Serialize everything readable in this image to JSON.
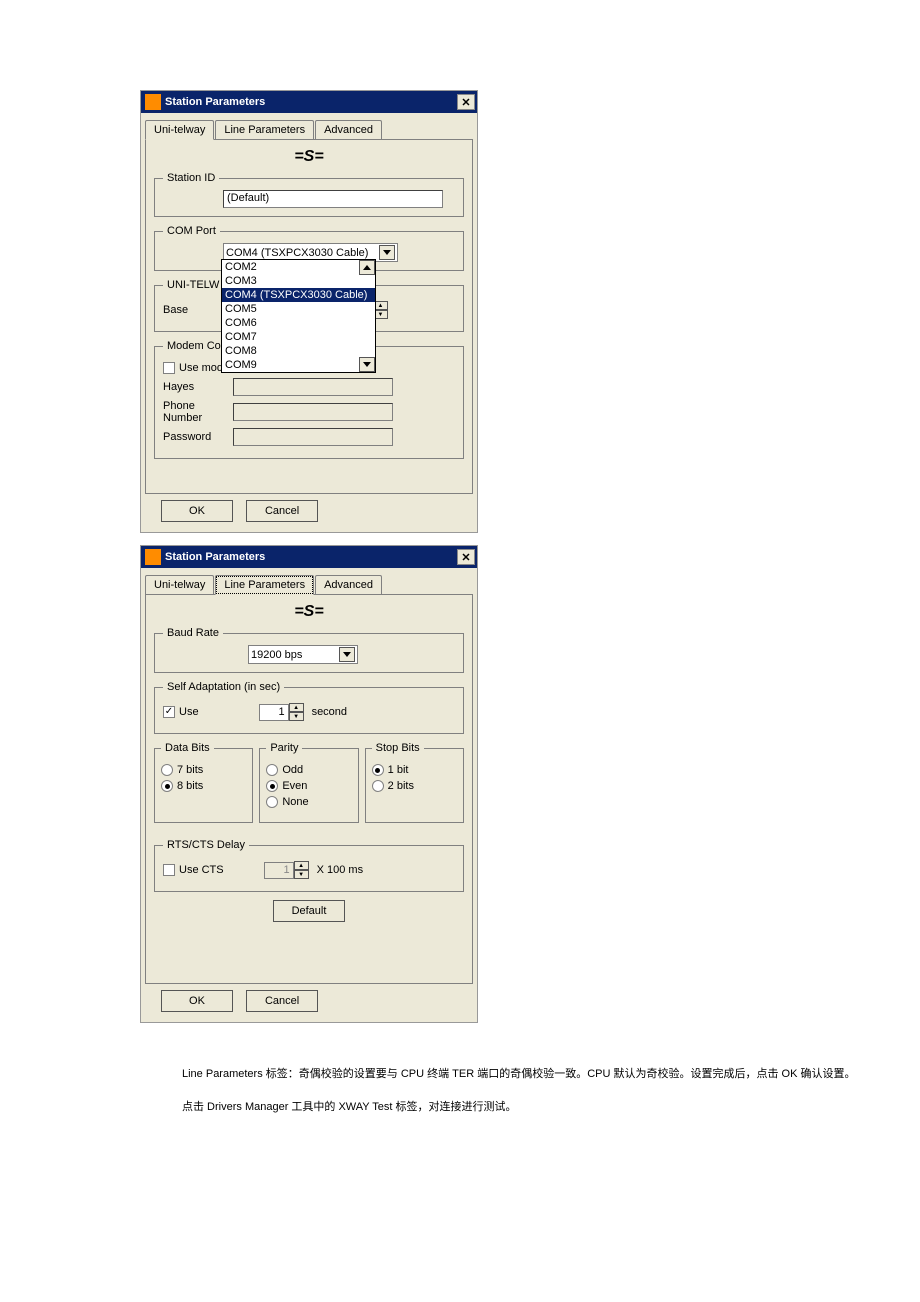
{
  "dialog1": {
    "title": "Station Parameters",
    "tabs": {
      "t1": "Uni-telway",
      "t2": "Line Parameters",
      "t3": "Advanced"
    },
    "station_id": {
      "legend": "Station ID",
      "value": "(Default)"
    },
    "com_port": {
      "legend": "COM Port",
      "selected": "COM4 (TSXPCX3030 Cable)",
      "options": [
        "COM2",
        "COM3",
        "COM4 (TSXPCX3030 Cable)",
        "COM5",
        "COM6",
        "COM7",
        "COM8",
        "COM9"
      ]
    },
    "unitelv": {
      "legend": "UNI-TELW",
      "base_label": "Base",
      "base_value": ""
    },
    "modem": {
      "legend": "Modem Co",
      "use_modem_label": "Use modem",
      "use_modem_checked": false,
      "hayes_label": "Hayes",
      "phone_label": "Phone Number",
      "password_label": "Password"
    },
    "ok": "OK",
    "cancel": "Cancel"
  },
  "dialog2": {
    "title": "Station Parameters",
    "tabs": {
      "t1": "Uni-telway",
      "t2": "Line Parameters",
      "t3": "Advanced"
    },
    "baud": {
      "legend": "Baud Rate",
      "value": "19200  bps"
    },
    "self_adapt": {
      "legend": "Self Adaptation (in sec)",
      "use_label": "Use",
      "use_checked": true,
      "value": "1",
      "unit": "second"
    },
    "databits": {
      "legend": "Data Bits",
      "r1": "7 bits",
      "r2": "8 bits",
      "selected": "8"
    },
    "parity": {
      "legend": "Parity",
      "r1": "Odd",
      "r2": "Even",
      "r3": "None",
      "selected": "Even"
    },
    "stopbits": {
      "legend": "Stop Bits",
      "r1": "1 bit",
      "r2": "2 bits",
      "selected": "1"
    },
    "rtscts": {
      "legend": "RTS/CTS Delay",
      "use_label": "Use CTS",
      "use_checked": false,
      "value": "1",
      "unit": "X 100 ms"
    },
    "default_btn": "Default",
    "ok": "OK",
    "cancel": "Cancel"
  },
  "text": {
    "p1": "Line Parameters 标签：奇偶校验的设置要与 CPU 终端 TER 端口的奇偶校验一致。CPU 默认为奇校验。设置完成后，点击 OK 确认设置。",
    "p2": "点击 Drivers Manager 工具中的 XWAY Test 标签，对连接进行测试。"
  }
}
